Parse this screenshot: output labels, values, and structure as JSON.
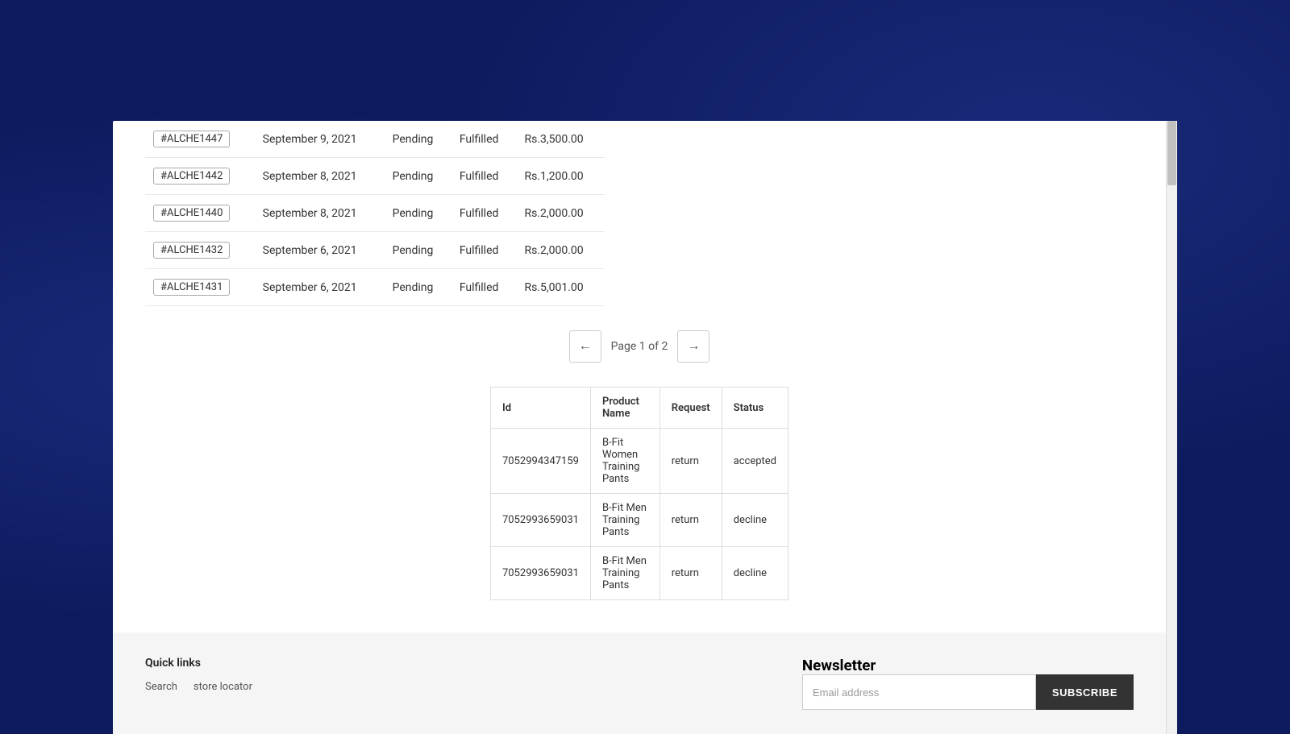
{
  "orders": {
    "rows": [
      {
        "id": "#ALCHE1447",
        "date": "September 9, 2021",
        "payment": "Pending",
        "fulfillment": "Fulfilled",
        "amount": "Rs.3,500.00"
      },
      {
        "id": "#ALCHE1442",
        "date": "September 8, 2021",
        "payment": "Pending",
        "fulfillment": "Fulfilled",
        "amount": "Rs.1,200.00"
      },
      {
        "id": "#ALCHE1440",
        "date": "September 8, 2021",
        "payment": "Pending",
        "fulfillment": "Fulfilled",
        "amount": "Rs.2,000.00"
      },
      {
        "id": "#ALCHE1432",
        "date": "September 6, 2021",
        "payment": "Pending",
        "fulfillment": "Fulfilled",
        "amount": "Rs.2,000.00"
      },
      {
        "id": "#ALCHE1431",
        "date": "September 6, 2021",
        "payment": "Pending",
        "fulfillment": "Fulfilled",
        "amount": "Rs.5,001.00"
      }
    ]
  },
  "pagination": {
    "text": "Page 1 of 2",
    "prev_label": "←",
    "next_label": "→"
  },
  "returns": {
    "headers": [
      "Id",
      "Product Name",
      "Request",
      "Status"
    ],
    "rows": [
      {
        "id": "7052994347159",
        "product": "B-Fit Women Training Pants",
        "request": "return",
        "status": "accepted"
      },
      {
        "id": "7052993659031",
        "product": "B-Fit Men Training Pants",
        "request": "return",
        "status": "decline"
      },
      {
        "id": "7052993659031",
        "product": "B-Fit Men Training Pants",
        "request": "return",
        "status": "decline"
      }
    ]
  },
  "footer": {
    "quick_links_title": "Quick links",
    "links": [
      "Search",
      "store locator"
    ],
    "newsletter_title": "Newsletter",
    "email_placeholder": "Email address",
    "subscribe_label": "SUBSCRIBE"
  }
}
